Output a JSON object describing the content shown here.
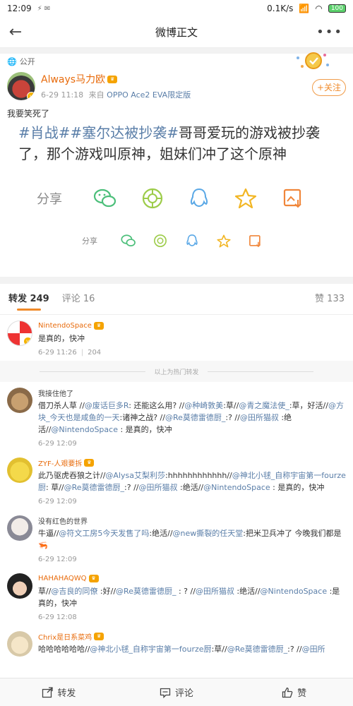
{
  "statusbar": {
    "time": "12:09",
    "network": "0.1K/s",
    "battery": "100"
  },
  "nav": {
    "title": "微博正文"
  },
  "post": {
    "visibility": "公开",
    "author": "Always马力欧",
    "time": "6-29 11:18",
    "source_prefix": "来自",
    "source": "OPPO Ace2 EVA限定版",
    "follow_label": "关注",
    "intro": "我要笑死了",
    "tags": [
      "#肖战#",
      "#塞尔达被抄袭#"
    ],
    "body_rest": "哥哥爱玩的游戏被抄袭了，那个游戏叫原神，姐妹们冲了这个原神",
    "share_label": "分享"
  },
  "tabs": {
    "repost": "转发",
    "repost_count": "249",
    "comment": "评论",
    "comment_count": "16",
    "like": "赞",
    "like_count": "133"
  },
  "hot_divider": "以上为热门转发",
  "reposts": [
    {
      "user": "NintendoSpace",
      "vip": true,
      "text": "是真的，快冲",
      "time": "6-29 11:26",
      "count": "204"
    },
    {
      "user": "我接住他了",
      "vip": false,
      "text": "借刀杀人草 //@废话巨多R: 还能这么用? //@种崎敦美:草//@青之魔法使_:草，好活//@方块_今天也是咸鱼的一天:诸神之战? //@Re莫德雷德厨_:? //@田所猫叔 :绝活//@NintendoSpace : 是真的，快冲",
      "time": "6-29 12:09"
    },
    {
      "user": "ZYF-人艰要拆",
      "vip": true,
      "text": "此乃驱虎吞狼之计//@Alysa艾梨利莎:hhhhhhhhhhhh//@神北小毬_自称宇宙第一fourze厨: 草//@Re莫德雷德厨_:? //@田所猫叔 :绝活//@NintendoSpace : 是真的，快冲",
      "time": "6-29 12:09"
    },
    {
      "user": "没有红色的世界",
      "vip": false,
      "text": "牛逼//@符文工房5今天发售了吗:绝活//@new撕裂的任天堂:把米卫兵冲了 今晚我们都是🦐",
      "time": "6-29 12:09"
    },
    {
      "user": "HAHAHAQWQ",
      "vip": true,
      "text": "草//@吉良的同僚 :好//@Re莫德雷德厨_ : ? //@田所猫叔 :绝活//@NintendoSpace :是真的，快冲",
      "time": "6-29 12:08"
    },
    {
      "user": "Chrix是日系菜鸡",
      "vip": true,
      "text": "哈哈哈哈哈哈//@神北小毬_自称宇宙第一fourze厨:草//@Re莫德雷德厨_:? //@田所",
      "time": ""
    }
  ],
  "bottombar": {
    "repost": "转发",
    "comment": "评论",
    "like": "赞"
  },
  "colors": {
    "accent": "#f08a2a",
    "link": "#5a7ea8",
    "username": "#e86b0c"
  }
}
